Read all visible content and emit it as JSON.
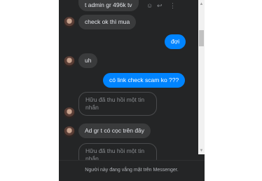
{
  "messages": [
    {
      "id": "m1",
      "direction": "incoming",
      "text": "t admin gr 496k tv"
    },
    {
      "id": "m2",
      "direction": "incoming",
      "text": "check ok thì mua"
    },
    {
      "id": "m3",
      "direction": "outgoing",
      "text": "đợi"
    },
    {
      "id": "m4",
      "direction": "incoming",
      "text": "uh"
    },
    {
      "id": "m5",
      "direction": "outgoing",
      "text": "có link check scam ko ???"
    },
    {
      "id": "m6",
      "direction": "incoming",
      "text": "Hữu đã thu hồi một tin nhắn",
      "recalled": true
    },
    {
      "id": "m7",
      "direction": "incoming",
      "text": "Ad gr t có cọc trên đây"
    },
    {
      "id": "m8",
      "direction": "incoming",
      "text": "Hữu đã thu hồi một tin nhắn",
      "recalled": true
    }
  ],
  "row_actions": {
    "react_icon": "smiley-icon",
    "reply_icon": "reply-icon",
    "more_icon": "more-vertical-icon"
  },
  "footer": {
    "status_text": "Người này đang vắng mặt trên Messenger."
  },
  "colors": {
    "chat_bg": "#242526",
    "incoming_bubble": "#3a3b3c",
    "outgoing_bubble": "#0084ff"
  }
}
